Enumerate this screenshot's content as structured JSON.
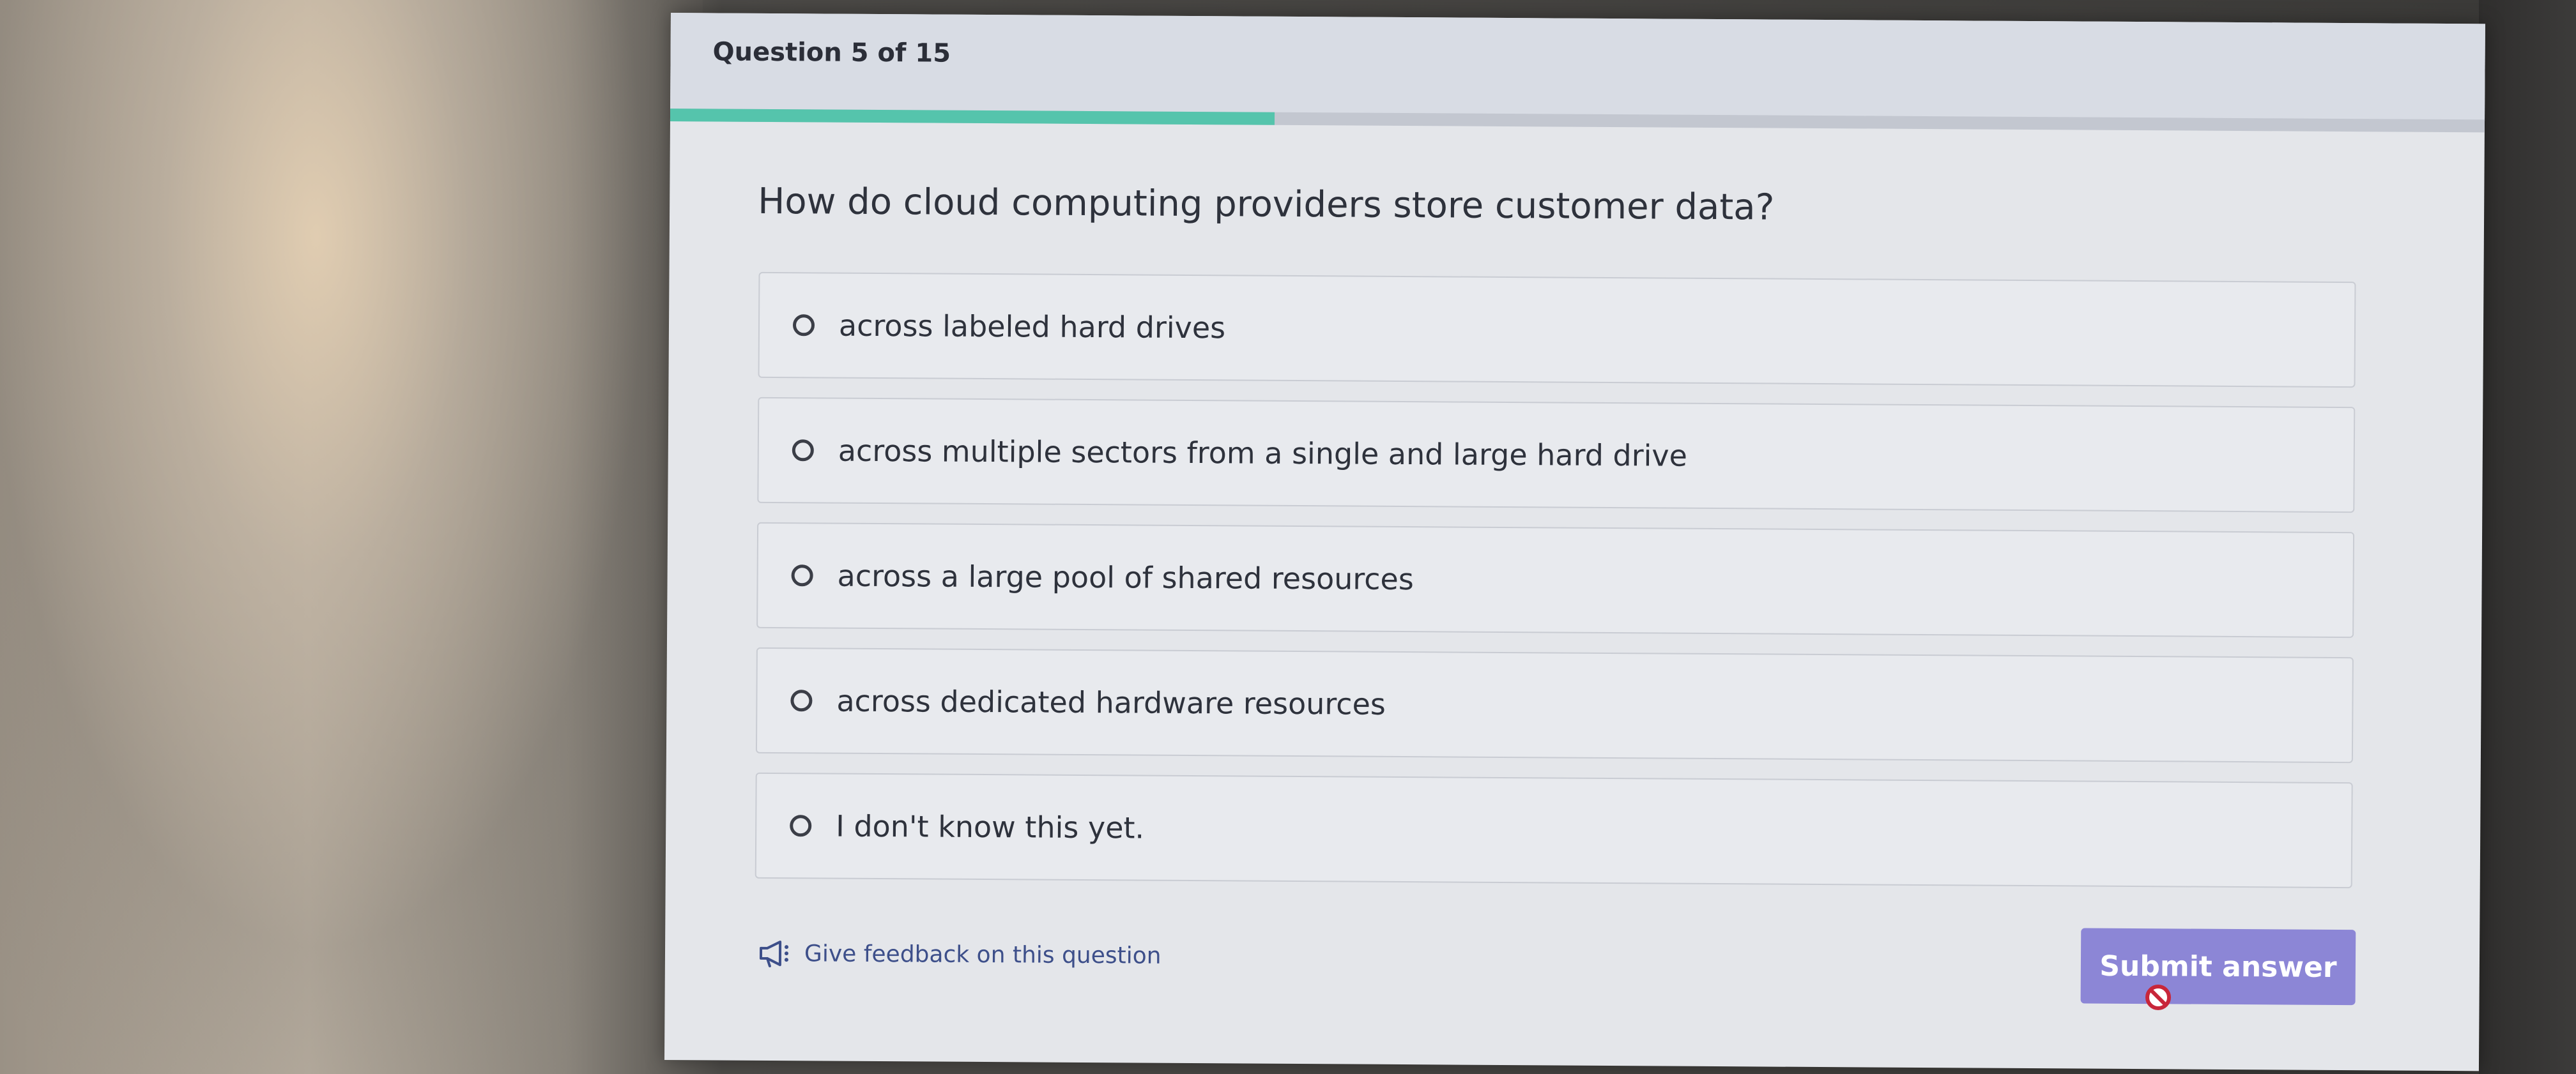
{
  "quiz": {
    "counter": "Question 5 of 15",
    "progress": 0.333,
    "question": "How do cloud computing providers store customer data?",
    "options": [
      {
        "label": "across labeled hard drives",
        "selected": false
      },
      {
        "label": "across multiple sectors from a single and large hard drive",
        "selected": false
      },
      {
        "label": "across a large pool of shared resources",
        "selected": false
      },
      {
        "label": "across dedicated hardware resources",
        "selected": false
      },
      {
        "label": "I don't know this yet.",
        "selected": false
      }
    ],
    "feedback_link": "Give feedback on this question",
    "submit_label": "Submit answer",
    "submit_enabled": false
  },
  "colors": {
    "progress_fill": "#55c4ac",
    "submit_bg": "#8c86d6",
    "link": "#3d4f8a"
  },
  "icons": {
    "feedback": "megaphone-icon",
    "cursor": "not-allowed-cursor-icon"
  }
}
